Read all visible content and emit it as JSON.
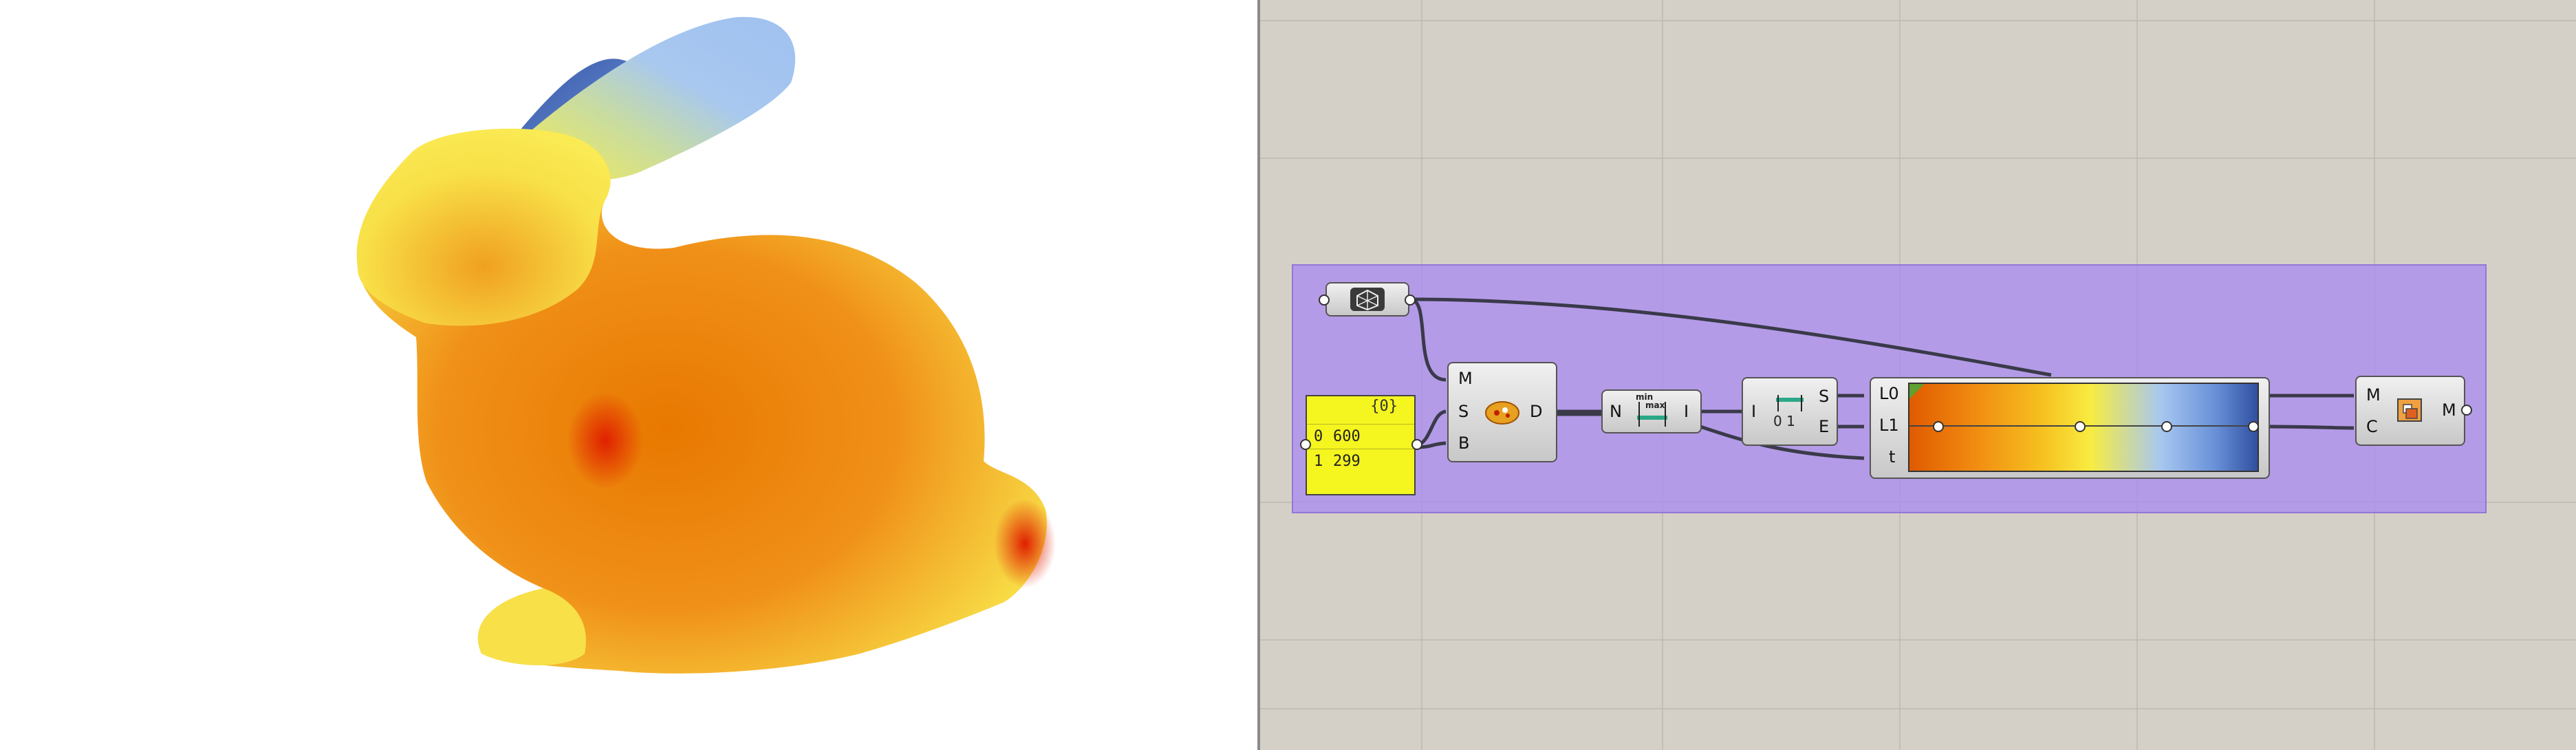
{
  "colors": {
    "canvas_bg": "#d4d0c8",
    "group_bg": "#b8a0ec",
    "panel_bg": "#f5f520",
    "gradient_stops": [
      "#e05a00",
      "#f08a10",
      "#f6c020",
      "#f8ec40",
      "#a8c8f0",
      "#6890d8",
      "#3050a0"
    ]
  },
  "viewport": {
    "object": "bunny-mesh"
  },
  "canvas": {
    "mesh_param": {
      "icon": "mesh-icon"
    },
    "panel": {
      "header": "{0}",
      "rows": [
        {
          "index": "0",
          "value": "600"
        },
        {
          "index": "1",
          "value": "299"
        }
      ]
    },
    "sample": {
      "inputs": [
        "M",
        "S",
        "B"
      ],
      "output": "D",
      "icon": "sample-icon"
    },
    "bounds": {
      "input": "N",
      "output": "I",
      "icon_top": "min",
      "icon_mid": "max"
    },
    "deconstruct": {
      "input": "I",
      "outputs": [
        "S",
        "E"
      ],
      "icon_text": "0 1"
    },
    "gradient": {
      "inputs": [
        "L0",
        "L1",
        "t"
      ]
    },
    "preview": {
      "inputs": [
        "M",
        "C"
      ],
      "output": "M",
      "icon": "mesh-colour-icon"
    }
  }
}
